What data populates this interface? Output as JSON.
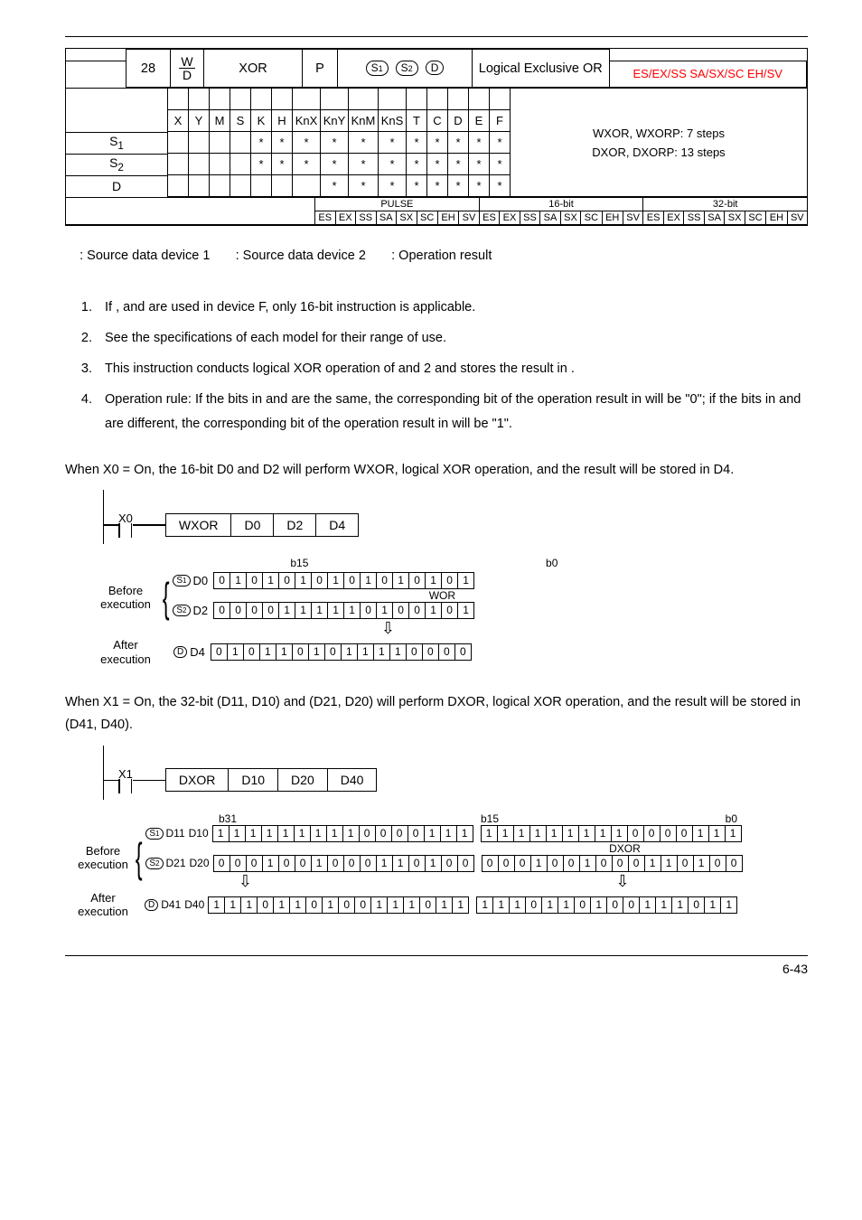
{
  "header": {
    "api_no": "28",
    "wd_top": "W",
    "wd_bot": "D",
    "mnemonic": "XOR",
    "p": "P",
    "sym_s1": "S1",
    "sym_s2": "S2",
    "sym_d": "D",
    "func_name": "Logical Exclusive OR",
    "controllers": "ES/EX/SS SA/SX/SC EH/SV"
  },
  "cols": [
    "X",
    "Y",
    "M",
    "S",
    "K",
    "H",
    "KnX",
    "KnY",
    "KnM",
    "KnS",
    "T",
    "C",
    "D",
    "E",
    "F"
  ],
  "rows": {
    "s1_label": "S<sub>1</sub>",
    "s2_label": "S<sub>2</sub>",
    "d_label": "D"
  },
  "grid": {
    "S1": [
      "",
      "",
      "",
      "",
      "*",
      "*",
      "*",
      "*",
      "*",
      "*",
      "*",
      "*",
      "*",
      "*",
      "*"
    ],
    "S2": [
      "",
      "",
      "",
      "",
      "*",
      "*",
      "*",
      "*",
      "*",
      "*",
      "*",
      "*",
      "*",
      "*",
      "*"
    ],
    "D": [
      "",
      "",
      "",
      "",
      "",
      "",
      "",
      "*",
      "*",
      "*",
      "*",
      "*",
      "*",
      "*",
      "*"
    ]
  },
  "steps": {
    "line1": "WXOR, WXORP: 7 steps",
    "line2": "DXOR, DXORP: 13 steps"
  },
  "pulse": {
    "h1": "PULSE",
    "h2": "16-bit",
    "h3": "32-bit",
    "cells": [
      "ES",
      "EX",
      "SS",
      "SA",
      "SX",
      "SC",
      "EH",
      "SV",
      "ES",
      "EX",
      "SS",
      "SA",
      "SX",
      "SC",
      "EH",
      "SV",
      "ES",
      "EX",
      "SS",
      "SA",
      "SX",
      "SC",
      "EH",
      "SV"
    ]
  },
  "operands_line": {
    "a": ": Source data device 1",
    "b": ": Source data device 2",
    "c": ": Operation result"
  },
  "explanations": [
    "If    ,       and     are used in device F, only 16-bit instruction is applicable.",
    "See the specifications of each model for their range of use.",
    "This instruction conducts logical XOR operation of       and    2 and stores the result in    .",
    "Operation rule: If the bits in       and       are the same, the corresponding bit of the operation result in     will be \"0\"; if the bits in       and       are different, the corresponding bit of the operation result in     will be \"1\"."
  ],
  "ex1_intro": "When X0 = On, the 16-bit D0 and D2 will perform WXOR, logical XOR operation, and the result will be stored in D4.",
  "ex1": {
    "contact": "X0",
    "mnem": "WXOR",
    "args": [
      "D0",
      "D2",
      "D4"
    ],
    "b15": "b15",
    "b0": "b0",
    "before": "Before\nexecution",
    "after": "After\nexecution",
    "wor_label": "WOR",
    "s1reg": "D0",
    "s2reg": "D2",
    "dreg": "D4",
    "d0": [
      "0",
      "1",
      "0",
      "1",
      "0",
      "1",
      "0",
      "1",
      "0",
      "1",
      "0",
      "1",
      "0",
      "1",
      "0",
      "1"
    ],
    "d2": [
      "0",
      "0",
      "0",
      "0",
      "1",
      "1",
      "1",
      "1",
      "1",
      "0",
      "1",
      "0",
      "0",
      "1",
      "0",
      "1"
    ],
    "d4": [
      "0",
      "1",
      "0",
      "1",
      "1",
      "0",
      "1",
      "0",
      "1",
      "1",
      "1",
      "1",
      "0",
      "0",
      "0",
      "0"
    ]
  },
  "ex2_intro": "When X1 = On, the 32-bit (D11, D10) and (D21, D20) will perform DXOR, logical XOR operation, and the result will be stored in (D41, D40).",
  "ex2": {
    "contact": "X1",
    "mnem": "DXOR",
    "args": [
      "D10",
      "D20",
      "D40"
    ],
    "b31": "b31",
    "b15": "b15",
    "b0": "b0",
    "before": "Before\nexecution",
    "after": "After\nexecution",
    "dxor_label": "DXOR",
    "regs": {
      "s1a": "D11",
      "s1b": "D10",
      "s2a": "D21",
      "s2b": "D20",
      "da": "D41",
      "db": "D40"
    },
    "d11": [
      "1",
      "1",
      "1",
      "1",
      "1",
      "1",
      "1",
      "1",
      "1",
      "0",
      "0",
      "0",
      "0",
      "1",
      "1",
      "1"
    ],
    "d10": [
      "1",
      "1",
      "1",
      "1",
      "1",
      "1",
      "1",
      "1",
      "1",
      "0",
      "0",
      "0",
      "0",
      "1",
      "1",
      "1"
    ],
    "d21": [
      "0",
      "0",
      "0",
      "1",
      "0",
      "0",
      "1",
      "0",
      "0",
      "0",
      "1",
      "1",
      "0",
      "1",
      "0",
      "0"
    ],
    "d20": [
      "0",
      "0",
      "0",
      "1",
      "0",
      "0",
      "1",
      "0",
      "0",
      "0",
      "1",
      "1",
      "0",
      "1",
      "0",
      "0"
    ],
    "d41": [
      "1",
      "1",
      "1",
      "0",
      "1",
      "1",
      "0",
      "1",
      "0",
      "0",
      "1",
      "1",
      "1",
      "0",
      "1",
      "1"
    ],
    "d40": [
      "1",
      "1",
      "1",
      "0",
      "1",
      "1",
      "0",
      "1",
      "0",
      "0",
      "1",
      "1",
      "1",
      "0",
      "1",
      "1"
    ]
  },
  "footer": "6-43"
}
